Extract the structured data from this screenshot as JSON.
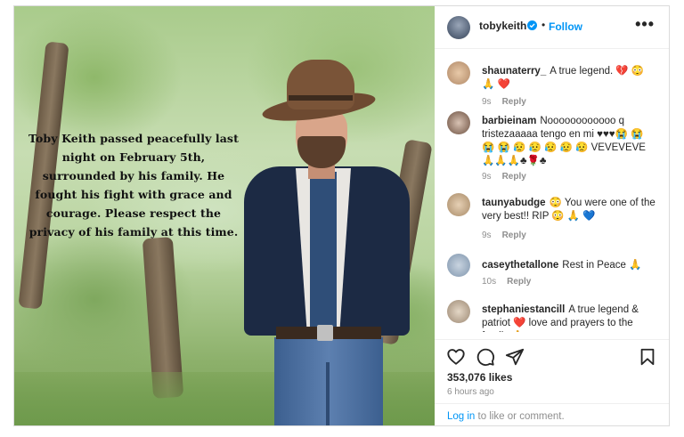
{
  "post": {
    "image_caption": "Toby Keith passed peacefully last night on February 5th, surrounded by his family. He fought his fight with grace and courage. Please respect the privacy of his family at this time.",
    "author": "tobykeith",
    "follow_label": "Follow",
    "dot": "•",
    "more_label": "•••"
  },
  "comments": [
    {
      "user": "shaunaterry_",
      "text": "A true legend. 💔 😳 🙏 ❤️",
      "time": "9s",
      "reply": "Reply"
    },
    {
      "user": "barbieinam",
      "text": "Noooooooooooo q tristezaaaaa tengo en mi ♥♥♥😭 😭 😭 😭 😥 😥 😥 😥 😥 VEVEVEVE🙏🙏🙏♣🌹♣",
      "time": "9s",
      "reply": "Reply"
    },
    {
      "user": "taunyabudge",
      "text": "😳 You were one of the very best!! RIP 😳 🙏 💙",
      "time": "9s",
      "reply": "Reply"
    },
    {
      "user": "caseythetallone",
      "text": "Rest in Peace 🙏",
      "time": "10s",
      "reply": "Reply"
    },
    {
      "user": "stephaniestancill",
      "text": "A true legend & patriot ❤️ love and prayers to the family 🙏",
      "time": "",
      "reply": ""
    }
  ],
  "stats": {
    "likes": "353,076 likes",
    "posted_ago": "6 hours ago"
  },
  "login": {
    "link": "Log in",
    "rest": " to like or comment."
  },
  "colors": {
    "accent": "#0095f6",
    "muted": "#8e8e8e",
    "text": "#262626"
  }
}
